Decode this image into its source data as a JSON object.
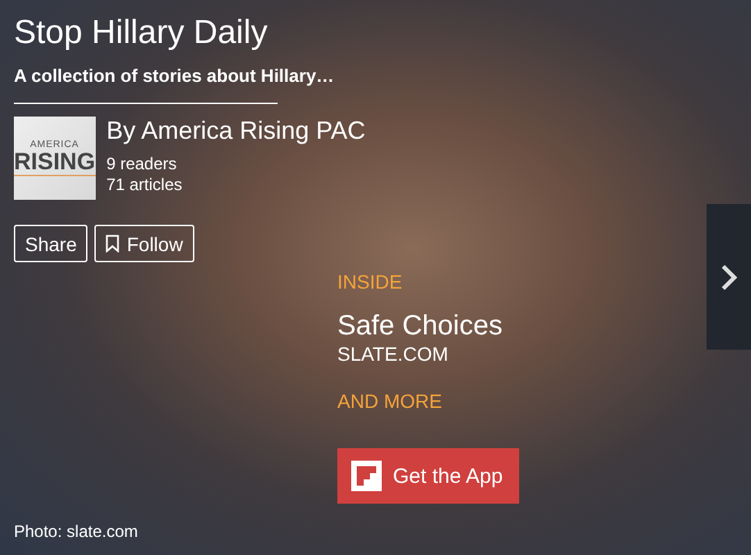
{
  "magazine": {
    "title": "Stop Hillary Daily",
    "subtitle": "A collection of stories about Hillary…",
    "logo": {
      "line_1": "AMERICA",
      "line_2": "RISING"
    },
    "author": "By America Rising PAC",
    "readers": "9 readers",
    "articles": "71 articles",
    "buttons": [
      {
        "kind": "share",
        "label": "Share"
      },
      {
        "kind": "follow",
        "label": "Follow"
      }
    ]
  },
  "inside": {
    "heading": "INSIDE",
    "story_title": "Safe Choices",
    "source": "SLATE.COM",
    "more": "AND MORE"
  },
  "cta": {
    "label": "Get the App"
  },
  "photo_credit": "Photo: slate.com"
}
